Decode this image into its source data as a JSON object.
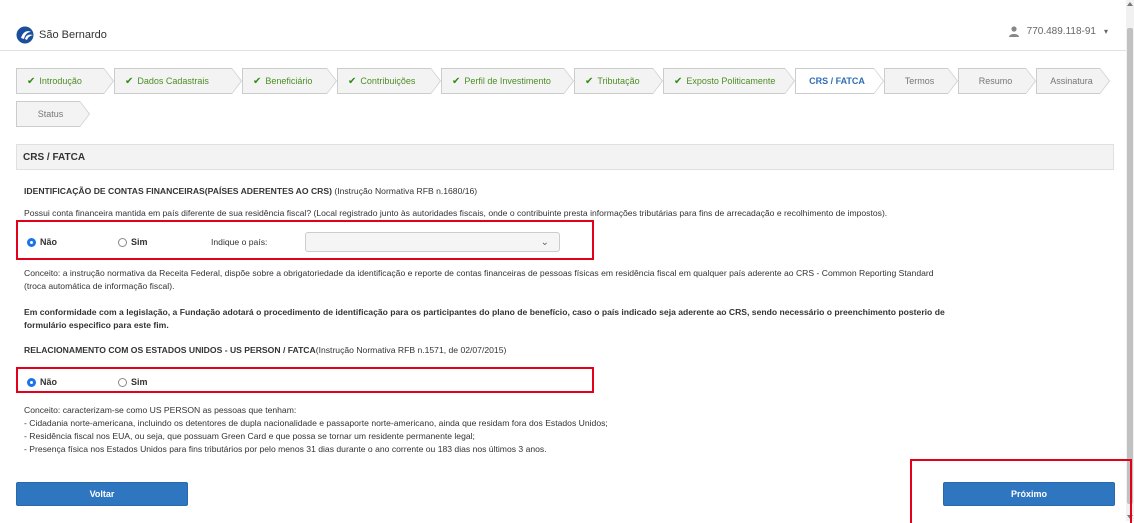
{
  "header": {
    "logo_text": "São Bernardo",
    "user_id": "770.489.118-91"
  },
  "wizard": {
    "steps": [
      {
        "label": "Introdução",
        "state": "done"
      },
      {
        "label": "Dados Cadastrais",
        "state": "done"
      },
      {
        "label": "Beneficiário",
        "state": "done"
      },
      {
        "label": "Contribuições",
        "state": "done"
      },
      {
        "label": "Perfil de Investimento",
        "state": "done"
      },
      {
        "label": "Tributação",
        "state": "done"
      },
      {
        "label": "Exposto Politicamente",
        "state": "done"
      },
      {
        "label": "CRS / FATCA",
        "state": "active"
      },
      {
        "label": "Termos",
        "state": "pending"
      },
      {
        "label": "Resumo",
        "state": "pending"
      },
      {
        "label": "Assinatura",
        "state": "pending"
      },
      {
        "label": "Status",
        "state": "pending"
      }
    ]
  },
  "section": {
    "title": "CRS / FATCA"
  },
  "crs": {
    "heading": "IDENTIFICAÇÃO DE CONTAS FINANCEIRAS(PAÍSES ADERENTES AO CRS)",
    "heading_ref": " (Instrução Normativa RFB n.1680/16)",
    "question": "Possui conta financeira mantida em país diferente de sua residência fiscal? (Local registrado junto às autoridades fiscais, onde o contribuinte presta informações tributárias para fins de arrecadação e recolhimento de impostos).",
    "option_no": "Não",
    "option_yes": "Sim",
    "selected": "Não",
    "country_label": "Indique o país:",
    "country_value": "",
    "concept_line1": "Conceito: a instrução normativa da Receita Federal, dispõe sobre a obrigatoriedade da identificação e reporte de contas financeiras de pessoas físicas em residência fiscal em qualquer país aderente ao CRS - Common Reporting Standard",
    "concept_line2": "(troca automática de informação fiscal).",
    "notice_line1": "Em conformidade com a legislação, a Fundação adotará o procedimento de identificação para os participantes do plano de benefício, caso o país indicado seja aderente ao CRS, sendo necessário o preenchimento posterio de",
    "notice_line2": "formulário especifico para este fim."
  },
  "fatca": {
    "heading": "RELACIONAMENTO COM OS ESTADOS UNIDOS - US PERSON / FATCA",
    "heading_ref": "(Instrução Normativa RFB n.1571, de 02/07/2015)",
    "option_no": "Não",
    "option_yes": "Sim",
    "selected": "Não",
    "concept_lines": [
      "Conceito: caracterizam-se como US PERSON as pessoas que tenham:",
      "- Cidadania norte-americana, incluindo os detentores de dupla nacionalidade e passaporte norte-americano, ainda que residam fora dos Estados Unidos;",
      "- Residência fiscal nos EUA, ou seja, que possuam Green Card e que possa se tornar um residente permanente legal;",
      "- Presença física nos Estados Unidos para fins tributários por pelo menos 31 dias durante o ano corrente ou 183 dias nos últimos 3 anos."
    ]
  },
  "buttons": {
    "back": "Voltar",
    "next": "Próximo"
  },
  "colors": {
    "primary": "#2f76c0",
    "highlight": "#e3001b",
    "done_check": "#2f8d14",
    "active_step": "#2d6db7"
  }
}
